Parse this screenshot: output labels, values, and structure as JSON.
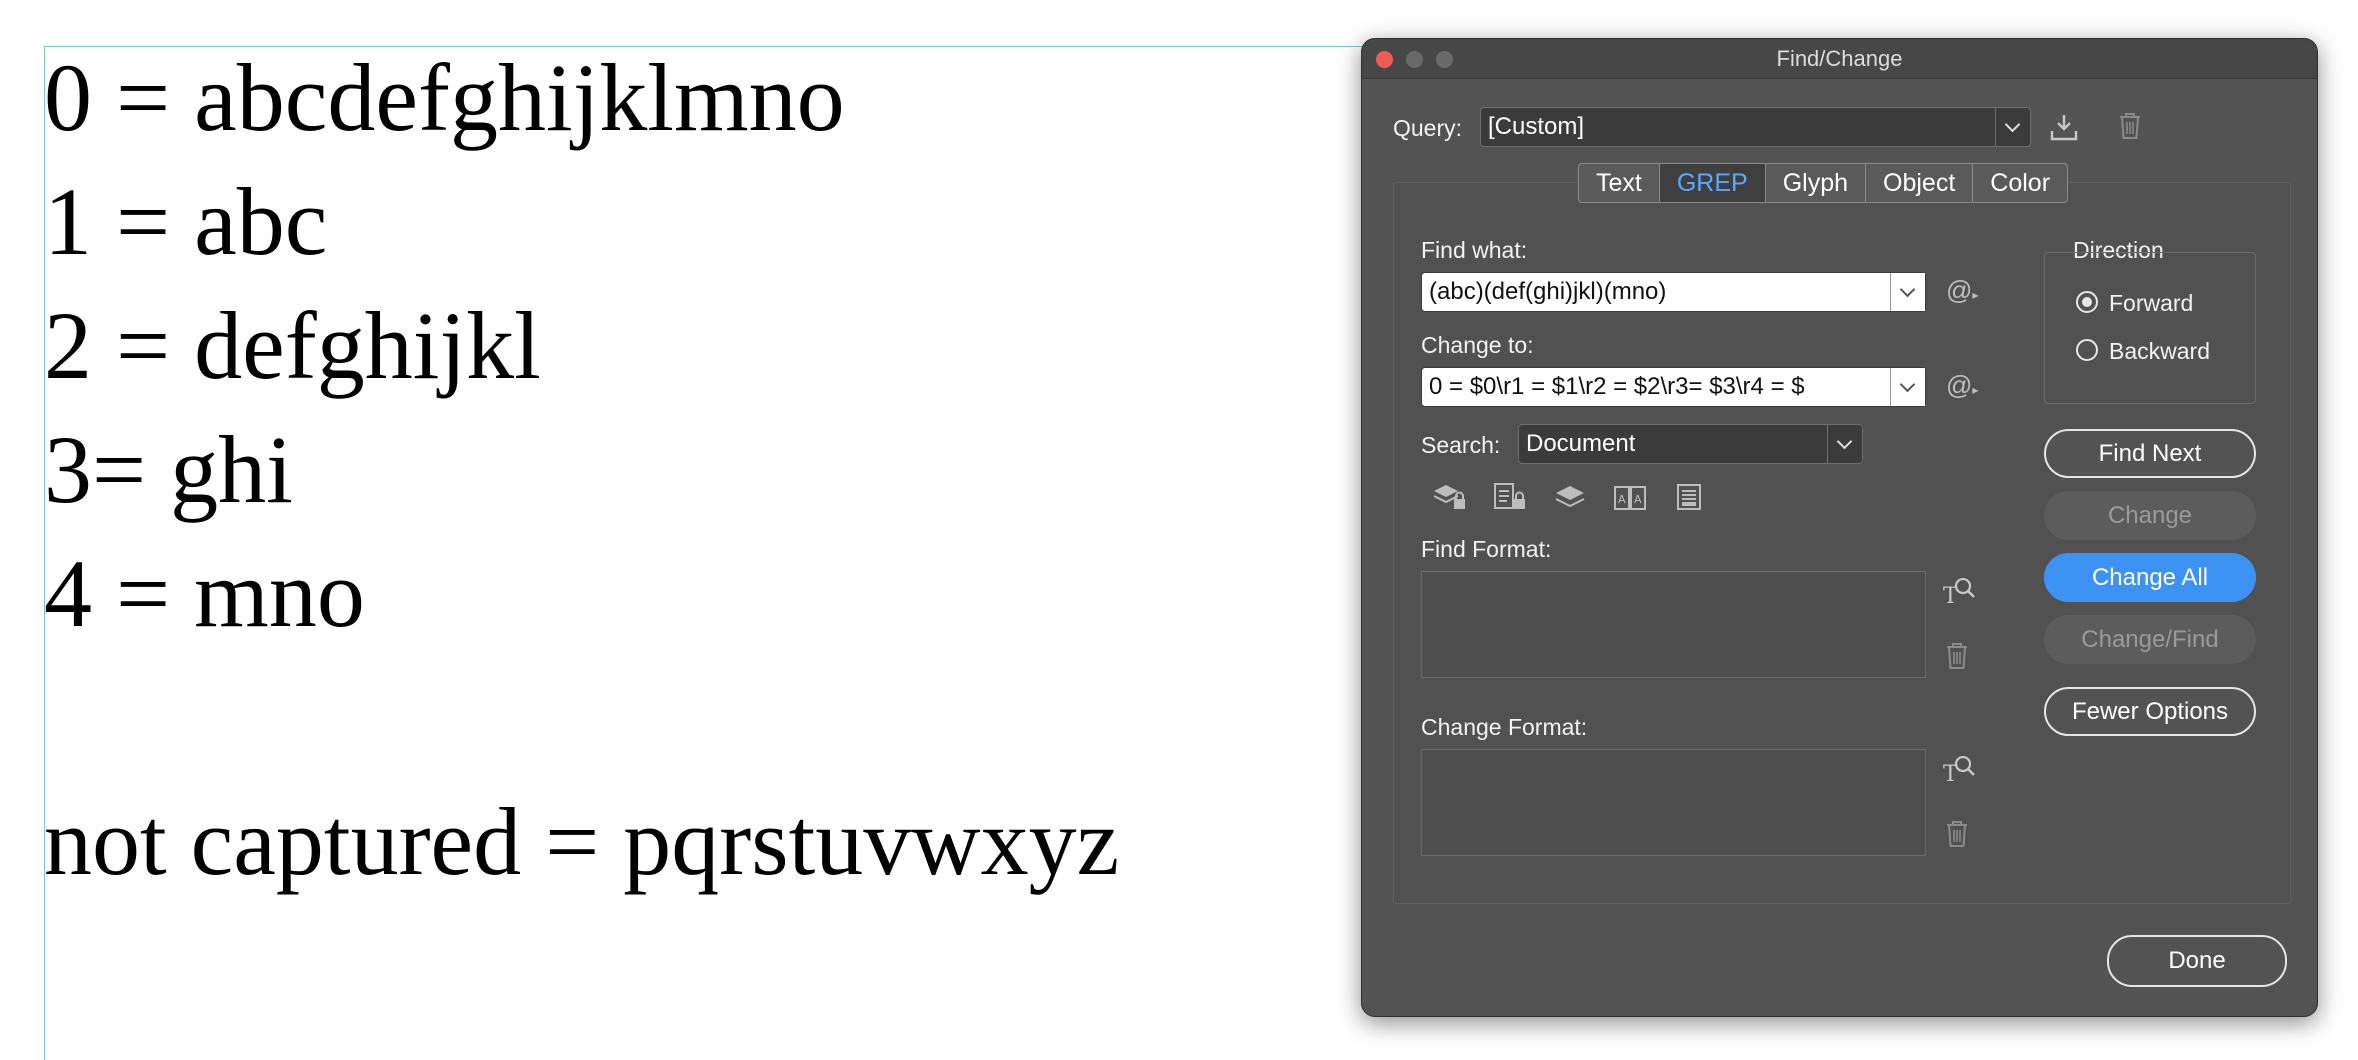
{
  "document": {
    "lines": [
      "0 = abcdefghijklmno",
      "1 = abc",
      "2 = defghijkl",
      "3= ghi",
      "4 = mno",
      "",
      "not captured = pqrstuvwxyz"
    ]
  },
  "dialog": {
    "title": "Find/Change",
    "query_label": "Query:",
    "query_value": "[Custom]",
    "tabs": [
      {
        "label": "Text",
        "active": false
      },
      {
        "label": "GREP",
        "active": true
      },
      {
        "label": "Glyph",
        "active": false
      },
      {
        "label": "Object",
        "active": false
      },
      {
        "label": "Color",
        "active": false
      }
    ],
    "find_what_label": "Find what:",
    "find_what_value": "(abc)(def(ghi)jkl)(mno)",
    "change_to_label": "Change to:",
    "change_to_value": "0 = $0\\r1 = $1\\r2 = $2\\r3= $3\\r4 = $",
    "search_label": "Search:",
    "search_value": "Document",
    "find_format_label": "Find Format:",
    "change_format_label": "Change Format:",
    "direction": {
      "label": "Direction",
      "options": [
        {
          "label": "Forward",
          "selected": true
        },
        {
          "label": "Backward",
          "selected": false
        }
      ]
    },
    "buttons": {
      "find_next": "Find Next",
      "change": "Change",
      "change_all": "Change All",
      "change_find": "Change/Find",
      "fewer_options": "Fewer Options",
      "done": "Done"
    },
    "special_char_symbol": "@",
    "colors": {
      "accent": "#3d93f4",
      "active_tab_text": "#5aa9ff",
      "close_light": "#ee5b57",
      "dialog_bg": "#535353"
    }
  }
}
